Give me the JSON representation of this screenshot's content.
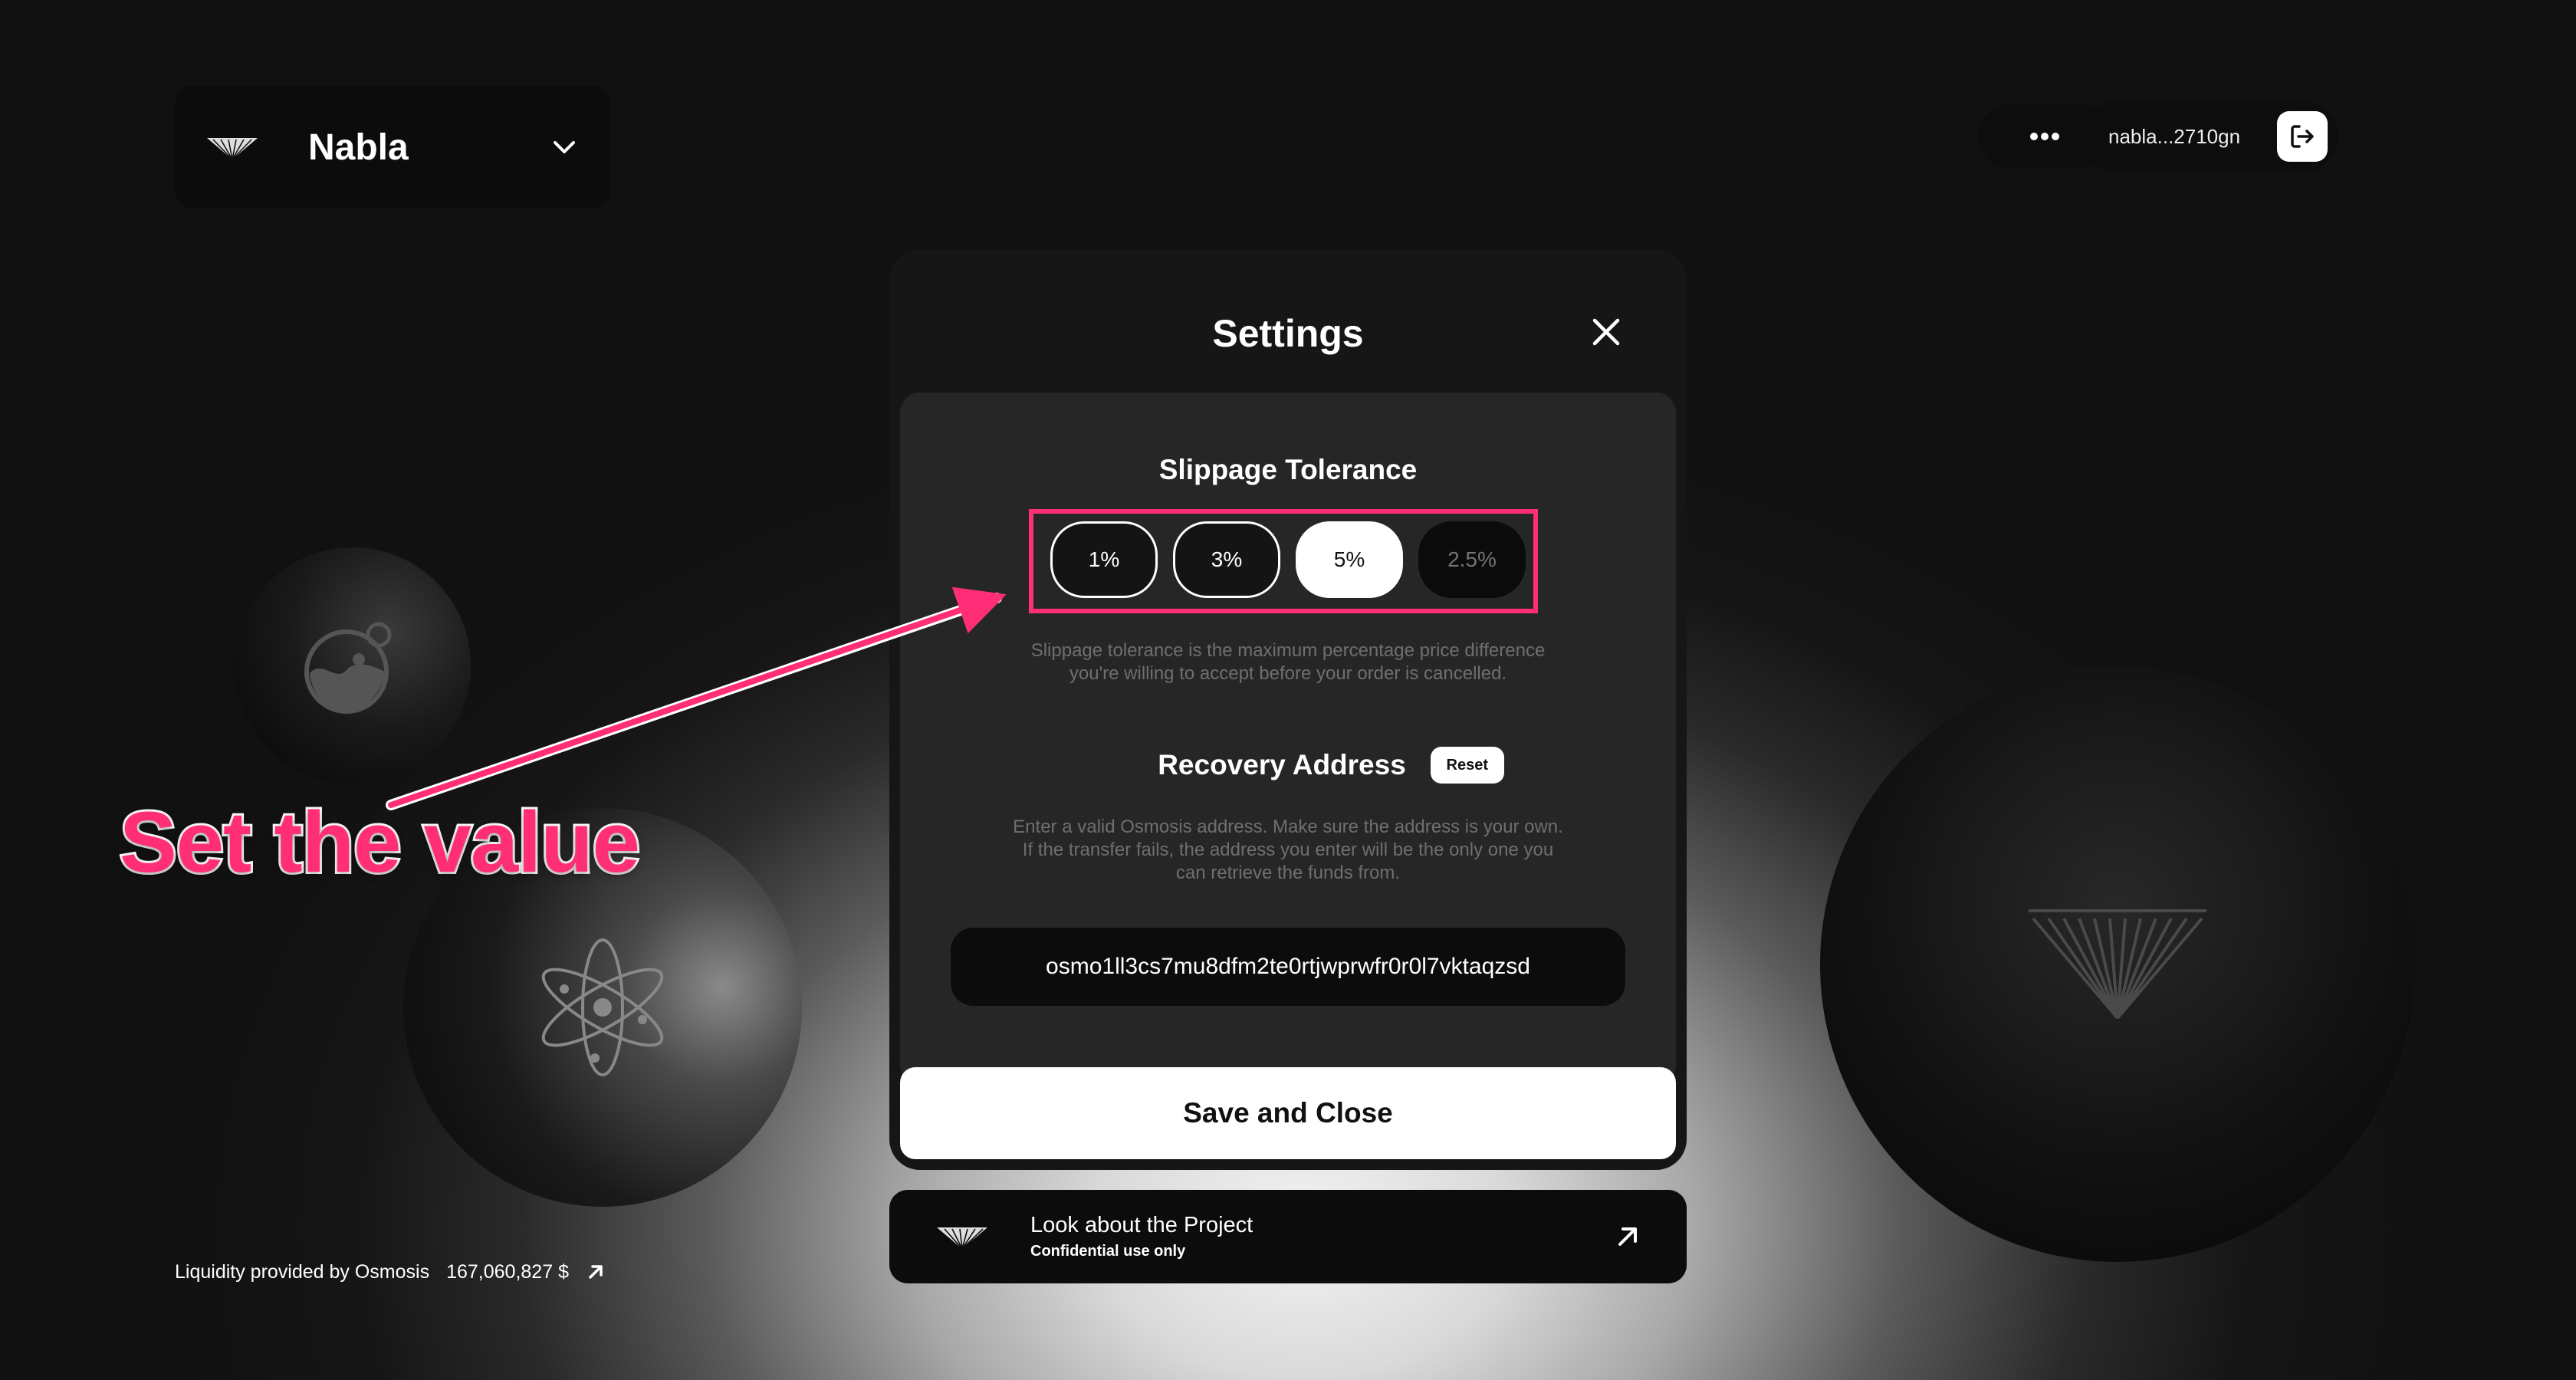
{
  "network": {
    "name": "Nabla",
    "logo_icon": "nabla-logo-icon",
    "chevron_icon": "chevron-down-icon"
  },
  "header": {
    "more_icon": "more-dots-icon",
    "wallet_address": "nabla...2710gn",
    "logout_icon": "logout-icon"
  },
  "coins": [
    "osmosis-coin-icon",
    "cosmos-atom-icon",
    "nabla-coin-icon"
  ],
  "liquidity": {
    "label": "Liquidity provided by Osmosis",
    "amount": "167,060,827 $"
  },
  "settings": {
    "title": "Settings",
    "slippage": {
      "title": "Slippage Tolerance",
      "options": [
        "1%",
        "3%",
        "5%"
      ],
      "selected": "5%",
      "custom_placeholder": "2.5%",
      "hint_line1": "Slippage tolerance is the maximum percentage price difference",
      "hint_line2": "you're willing to accept before your order is cancelled."
    },
    "recovery": {
      "title": "Recovery Address",
      "reset_label": "Reset",
      "hint_line1": "Enter a valid Osmosis address. Make sure the address is your own.",
      "hint_line2": "If the transfer fails, the address you enter will be the only one you",
      "hint_line3": "can retrieve the funds from.",
      "address_value": "osmo1ll3cs7mu8dfm2te0rtjwprwfr0r0l7vktaqzsd"
    },
    "save_label": "Save and Close"
  },
  "project_card": {
    "title": "Look about the Project",
    "subtitle": "Confidential use only"
  },
  "annotation": {
    "text": "Set the value",
    "color": "#ff2e77"
  }
}
